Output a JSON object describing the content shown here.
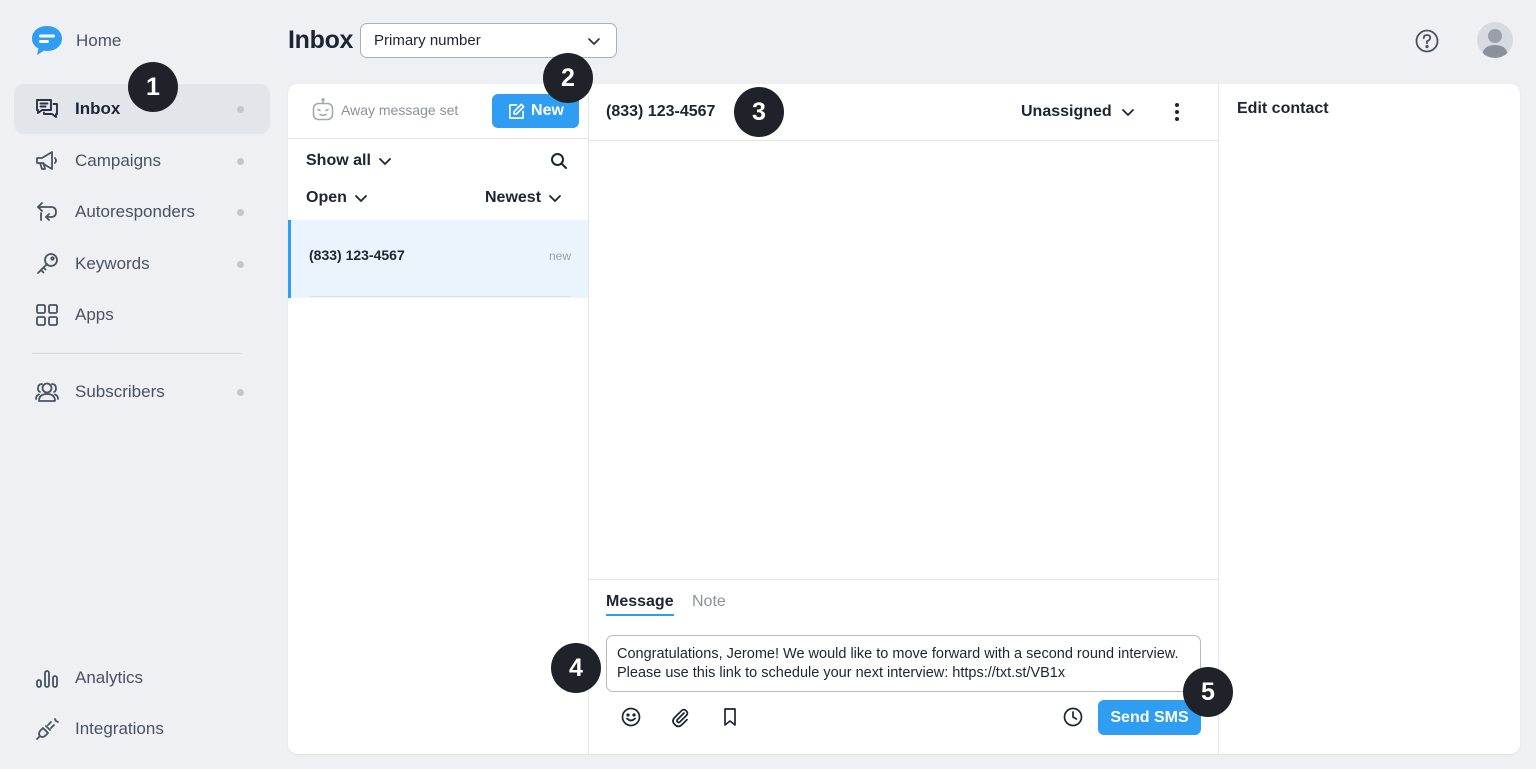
{
  "sidebar": {
    "home_label": "Home",
    "items": [
      {
        "label": "Inbox",
        "icon": "chat-bubbles-icon"
      },
      {
        "label": "Campaigns",
        "icon": "megaphone-icon"
      },
      {
        "label": "Autoresponders",
        "icon": "autoreply-arrows-icon"
      },
      {
        "label": "Keywords",
        "icon": "key-icon"
      },
      {
        "label": "Apps",
        "icon": "apps-grid-icon"
      },
      {
        "label": "Subscribers",
        "icon": "users-icon"
      },
      {
        "label": "Analytics",
        "icon": "bar-chart-icon"
      },
      {
        "label": "Integrations",
        "icon": "plug-icon"
      }
    ]
  },
  "topbar": {
    "title": "Inbox",
    "number_select_value": "Primary number"
  },
  "list": {
    "away_label": "Away message set",
    "new_label": "New",
    "filter_show": "Show all",
    "filter_status": "Open",
    "filter_sort": "Newest",
    "conversations": [
      {
        "number": "(833) 123-4567",
        "badge": "new"
      }
    ]
  },
  "chat": {
    "number": "(833) 123-4567",
    "assignee": "Unassigned",
    "tab_message": "Message",
    "tab_note": "Note",
    "message_text": "Congratulations, Jerome! We would like to move forward with a second round interview. Please use this link to schedule your next interview: https://txt.st/VB1x",
    "send_label": "Send SMS"
  },
  "contact": {
    "title": "Edit contact"
  },
  "steps": [
    "1",
    "2",
    "3",
    "4",
    "5"
  ],
  "colors": {
    "accent": "#2f9ef2",
    "step_marker": "#1f2329",
    "selected_row": "#e9f4fd"
  }
}
